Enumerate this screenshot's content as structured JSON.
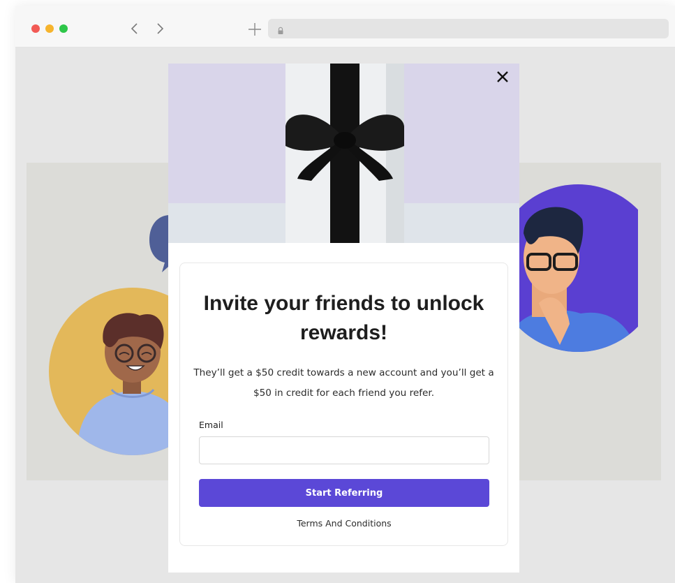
{
  "browser": {
    "window_controls": [
      "close",
      "minimize",
      "maximize"
    ],
    "nav_icons": [
      "chevron-left-icon",
      "chevron-right-icon",
      "plus-icon",
      "lock-icon"
    ],
    "url": ""
  },
  "modal": {
    "title": "Invite your friends to unlock rewards!",
    "description": "They’ll get a $50 credit towards a new account and you’ll get a $50 in credit for each friend you refer.",
    "email_label": "Email",
    "email_value": "",
    "email_placeholder": "",
    "cta_label": "Start Referring",
    "terms_link": "Terms And Conditions",
    "close_icon": "close-icon",
    "hero_image": "gift-box-with-black-ribbon"
  },
  "colors": {
    "accent": "#5b48d7",
    "background": "#e6e6e6",
    "band": "#dcdcd8",
    "avatar_left": "#e3b85a",
    "avatar_right": "#5a3fd1"
  }
}
